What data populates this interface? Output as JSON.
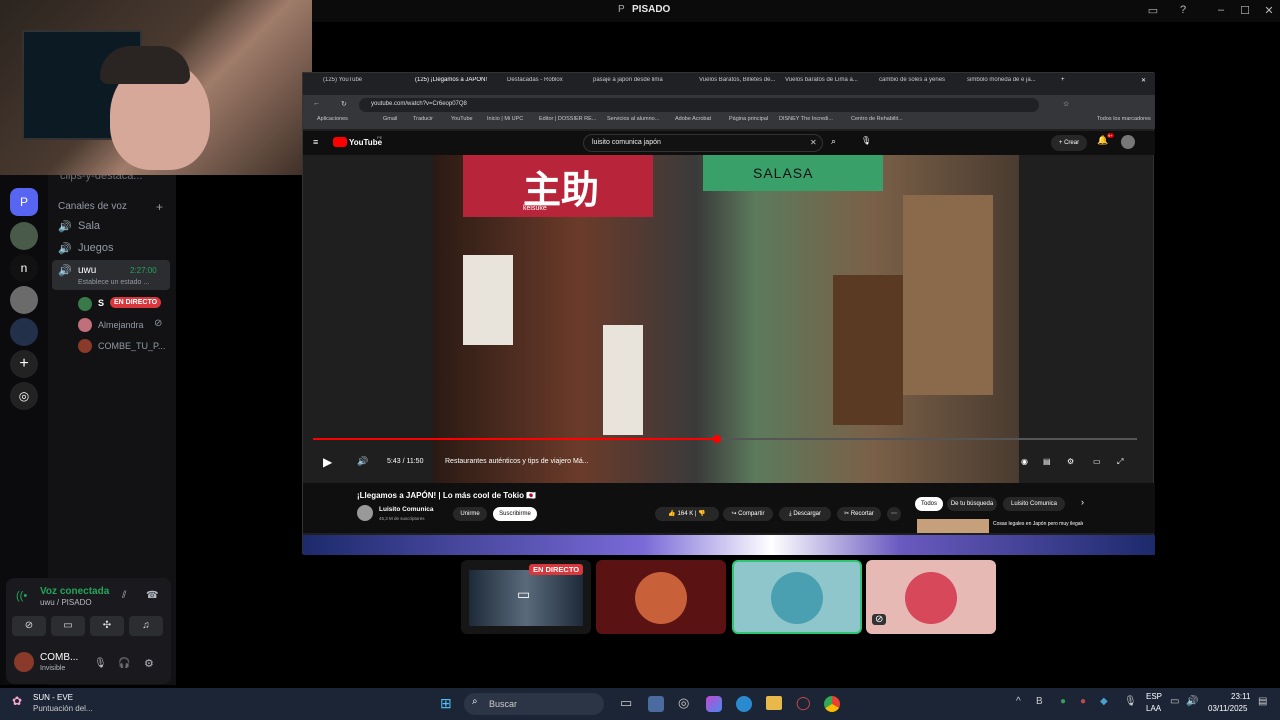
{
  "window": {
    "title": "PISADO",
    "title_initial": "P"
  },
  "discord": {
    "guild_letters": [
      "P",
      "n"
    ],
    "channel_partial": "clips-y-destaca...",
    "voice_category": "Canales de voz",
    "voice_channels": [
      "Sala",
      "Juegos",
      "uwu"
    ],
    "uwu_timer": "2:27:00",
    "uwu_status": "Establece un estado ...",
    "members": [
      {
        "name": "S",
        "badge": "EN DIRECTO"
      },
      {
        "name": "Almejandra"
      },
      {
        "name": "COMBE_TU_P..."
      }
    ],
    "voice_connected": "Voz conectada",
    "voice_location": "uwu / PISADO",
    "user_name": "COMB...",
    "user_status": "Invisible"
  },
  "browser": {
    "tabs": [
      "(125) YouTube",
      "(125) ¡Llegamos a JAPÓN!",
      "Destacadas - Roblox",
      "pasaje a japon desde lima",
      "Vuelos Baratos, Billetes de...",
      "Vuelos baratos de Lima a...",
      "cambio de soles a yenes",
      "simbolo moneda de e ja..."
    ],
    "url": "youtube.com/watch?v=Cr6eop07Q8",
    "bookmarks": [
      "Aplicaciones",
      "Gmail",
      "Traducir",
      "YouTube",
      "Inicio | Mi UPC",
      "Editor | DOSSIER RE...",
      "Servicios al alumno...",
      "Adobe Acrobat",
      "Página principal",
      "DISNEY The Incredi...",
      "Centro de Rehabilit..."
    ],
    "bookmarks_all": "Todos los marcadores"
  },
  "youtube": {
    "logo": "YouTube",
    "logo_sup": "PE",
    "search": "luisito comunica japón",
    "create": "Crear",
    "notifications": "9+",
    "video_sign_kanji": "主助",
    "video_sign_roman": "keisuke",
    "video_sign_green": "SALASA",
    "time": "5:43 / 11:50",
    "chapter": "Restaurantes auténticos y tips de viajero Má...",
    "progress": 0.49,
    "video_title": "¡Llegamos a JAPÓN! | Lo más cool de Tokio 🇯🇵",
    "channel": "Luisito Comunica",
    "subs": "45,3 M de suscriptores",
    "join": "Unirme",
    "subscribe": "Suscribirme",
    "likes": "164 K",
    "share": "Compartir",
    "download": "Descargar",
    "clip": "Recortar",
    "chips": [
      "Todos",
      "De tu búsqueda",
      "Luisito Comunica"
    ],
    "related_title": "Cosas legales en Japón pero muy ilegales en otros países |"
  },
  "participants": {
    "live_badge": "EN DIRECTO"
  },
  "taskbar": {
    "weather_title": "SUN - EVE",
    "weather_sub": "Puntuación del...",
    "search": "Buscar",
    "lang": "ESP",
    "lang2": "LAA",
    "time": "23:11",
    "date": "03/11/2025"
  }
}
